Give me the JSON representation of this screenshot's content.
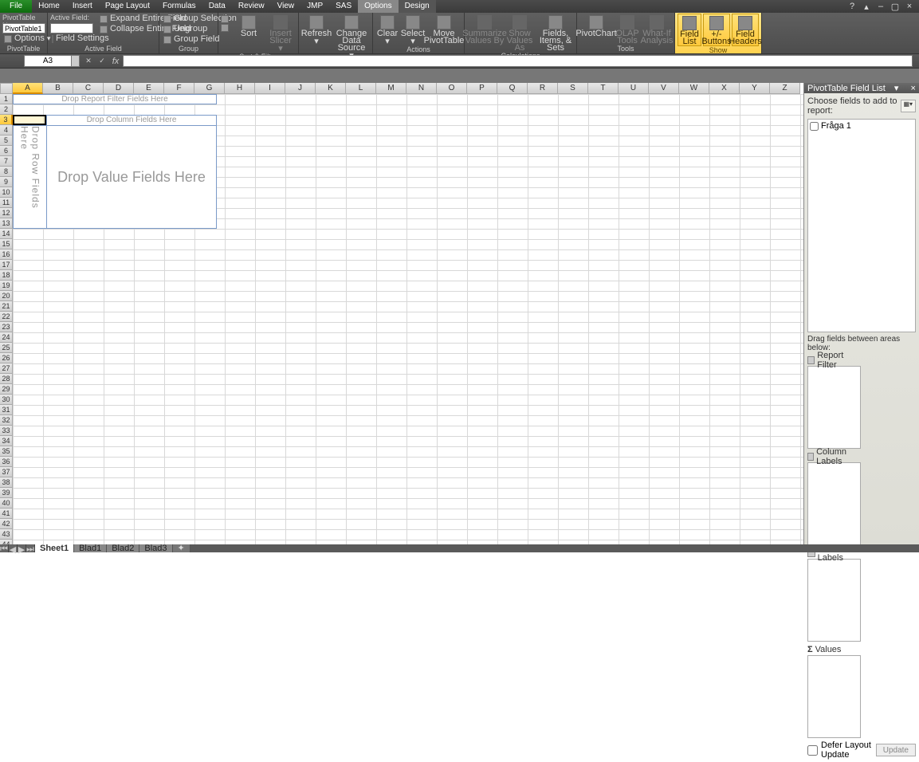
{
  "tabs": {
    "file": "File",
    "home": "Home",
    "insert": "Insert",
    "pagelayout": "Page Layout",
    "formulas": "Formulas",
    "data": "Data",
    "review": "Review",
    "view": "View",
    "jmp": "JMP",
    "sas": "SAS",
    "options": "Options",
    "design": "Design"
  },
  "ribbon": {
    "pivottable": {
      "name_lbl": "PivotTable Name:",
      "name_val": "PivotTable1",
      "options": "Options",
      "group_lbl": "PivotTable"
    },
    "activefield": {
      "af_lbl": "Active Field:",
      "expand": "Expand Entire Field",
      "collapse": "Collapse Entire Field",
      "settings": "Field Settings",
      "group_lbl": "Active Field"
    },
    "group": {
      "sel": "Group Selection",
      "ungroup": "Ungroup",
      "field": "Group Field",
      "group_lbl": "Group"
    },
    "sortfilter": {
      "sort": "Sort",
      "slicer": "Insert Slicer",
      "group_lbl": "Sort & Filter"
    },
    "data": {
      "refresh": "Refresh",
      "src": "Change Data Source",
      "group_lbl": "Data"
    },
    "actions": {
      "clear": "Clear",
      "select": "Select",
      "move": "Move PivotTable",
      "group_lbl": "Actions"
    },
    "calc": {
      "summ": "Summarize Values By",
      "show": "Show Values As",
      "fields": "Fields, Items, & Sets",
      "group_lbl": "Calculations"
    },
    "tools": {
      "chart": "PivotChart",
      "olap": "OLAP Tools",
      "whatif": "What-If Analysis",
      "group_lbl": "Tools"
    },
    "show": {
      "list": "Field List",
      "btns": "+/- Buttons",
      "hdrs": "Field Headers",
      "group_lbl": "Show"
    }
  },
  "namebox": "A3",
  "columns": [
    "A",
    "B",
    "C",
    "D",
    "E",
    "F",
    "G",
    "H",
    "I",
    "J",
    "K",
    "L",
    "M",
    "N",
    "O",
    "P",
    "Q",
    "R",
    "S",
    "T",
    "U",
    "V",
    "W",
    "X",
    "Y",
    "Z"
  ],
  "pivot": {
    "filter": "Drop Report Filter Fields Here",
    "col": "Drop Column Fields Here",
    "row": "Drop Row Fields Here",
    "val": "Drop Value Fields Here"
  },
  "fieldlist": {
    "title": "PivotTable Field List",
    "choose": "Choose fields to add to report:",
    "fields": [
      "Fråga 1"
    ],
    "drag": "Drag fields between areas below:",
    "areas": {
      "filter": "Report Filter",
      "col": "Column Labels",
      "row": "Row Labels",
      "val": "Values"
    },
    "defer": "Defer Layout Update",
    "update": "Update"
  },
  "sheets": {
    "s1": "Sheet1",
    "s2": "Blad1",
    "s3": "Blad2",
    "s4": "Blad3"
  }
}
